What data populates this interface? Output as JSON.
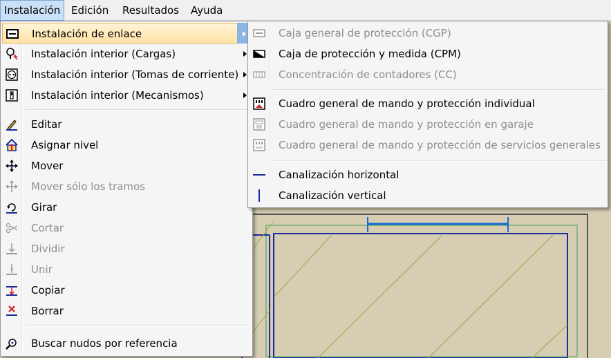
{
  "menubar": {
    "items": [
      {
        "label": "Instalación"
      },
      {
        "label": "Edición"
      },
      {
        "label": "Resultados"
      },
      {
        "label": "Ayuda"
      }
    ]
  },
  "main_menu": {
    "items": [
      {
        "label": "Instalación de enlace",
        "icon": "rectangle-box-icon",
        "submenu": true,
        "enabled": true
      },
      {
        "label": "Instalación interior (Cargas)",
        "icon": "bulb-icon",
        "submenu": true,
        "enabled": true
      },
      {
        "label": "Instalación interior (Tomas de corriente)",
        "icon": "socket-icon",
        "submenu": true,
        "enabled": true
      },
      {
        "label": "Instalación interior (Mecanismos)",
        "icon": "switch-icon",
        "submenu": true,
        "enabled": true
      },
      {
        "label": "Editar",
        "icon": "pencil-icon",
        "enabled": true
      },
      {
        "label": "Asignar nivel",
        "icon": "house-level-icon",
        "enabled": true
      },
      {
        "label": "Mover",
        "icon": "move-icon",
        "enabled": true
      },
      {
        "label": "Mover sólo los tramos",
        "icon": "move-segments-icon",
        "enabled": false
      },
      {
        "label": "Girar",
        "icon": "rotate-icon",
        "enabled": true
      },
      {
        "label": "Cortar",
        "icon": "scissors-icon",
        "enabled": false
      },
      {
        "label": "Dividir",
        "icon": "divide-icon",
        "enabled": false
      },
      {
        "label": "Unir",
        "icon": "join-icon",
        "enabled": false
      },
      {
        "label": "Copiar",
        "icon": "copy-icon",
        "enabled": true
      },
      {
        "label": "Borrar",
        "icon": "delete-icon",
        "enabled": true
      },
      {
        "label": "Buscar nudos por referencia",
        "icon": "search-nodes-icon",
        "enabled": true
      }
    ]
  },
  "submenu": {
    "items": [
      {
        "label": "Caja general de protección (CGP)",
        "icon": "cgp-icon",
        "enabled": false
      },
      {
        "label": "Caja de protección y medida (CPM)",
        "icon": "cpm-icon",
        "enabled": true
      },
      {
        "label": "Concentración de contadores (CC)",
        "icon": "meter-concentration-icon",
        "enabled": false
      },
      {
        "label": "Cuadro general de mando y protección individual",
        "icon": "panel-individual-icon",
        "enabled": true
      },
      {
        "label": "Cuadro general de mando y protección en garaje",
        "icon": "panel-garage-icon",
        "enabled": false
      },
      {
        "label": "Cuadro general de mando y protección de servicios generales",
        "icon": "panel-services-icon",
        "enabled": false
      },
      {
        "label": "Canalización horizontal",
        "icon": "horizontal-line-icon",
        "enabled": true
      },
      {
        "label": "Canalización vertical",
        "icon": "vertical-line-icon",
        "enabled": true
      }
    ]
  },
  "colors": {
    "highlight": "#ffe2a5",
    "canvas": "#d7cdb2",
    "accent_blue": "#1b2a9c",
    "accent_red": "#d42020"
  }
}
